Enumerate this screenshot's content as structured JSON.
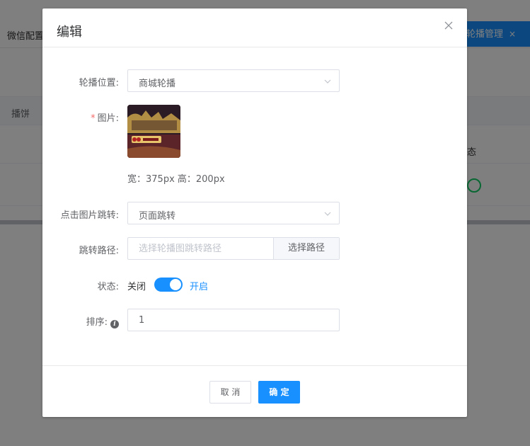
{
  "background": {
    "left_tab": "微信配置",
    "right_tab": "轮播管理",
    "right_tab_close": "×",
    "table_header_label": "播饼",
    "status_column": "态"
  },
  "dialog": {
    "title": "编辑",
    "fields": {
      "position": {
        "label": "轮播位置:",
        "value": "商城轮播"
      },
      "image": {
        "required_mark": "*",
        "label": "图片:",
        "size_text": "宽：375px 高：200px"
      },
      "jump_type": {
        "label": "点击图片跳转:",
        "value": "页面跳转"
      },
      "jump_path": {
        "label": "跳转路径:",
        "placeholder": "选择轮播图跳转路径",
        "button": "选择路径"
      },
      "status": {
        "label": "状态:",
        "off_text": "关闭",
        "on_text": "开启",
        "checked": true
      },
      "sort": {
        "label": "排序:",
        "value": "1"
      }
    },
    "footer": {
      "cancel": "取 消",
      "confirm": "确 定"
    }
  },
  "colors": {
    "primary": "#1890ff",
    "required": "#f56c6c",
    "success": "#13ce66"
  },
  "icons": {
    "close": "close-icon",
    "dropdown": "chevron-down-icon",
    "info": "info-icon"
  }
}
